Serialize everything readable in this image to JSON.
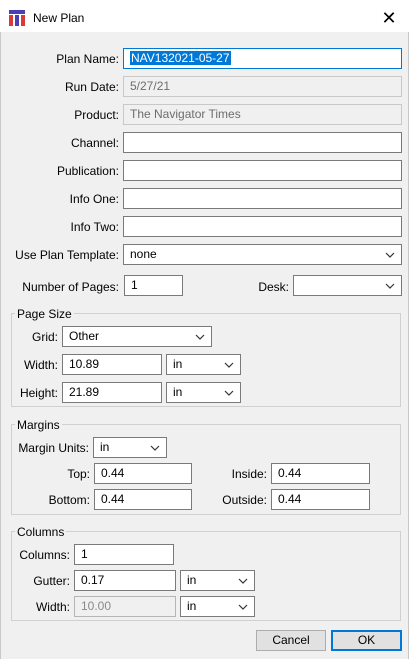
{
  "window": {
    "title": "New Plan"
  },
  "form": {
    "plan_name": {
      "label": "Plan Name:",
      "value": "NAV132021-05-27"
    },
    "run_date": {
      "label": "Run Date:",
      "value": "5/27/21"
    },
    "product": {
      "label": "Product:",
      "value": "The Navigator Times"
    },
    "channel": {
      "label": "Channel:",
      "value": ""
    },
    "publication": {
      "label": "Publication:",
      "value": ""
    },
    "info_one": {
      "label": "Info One:",
      "value": ""
    },
    "info_two": {
      "label": "Info Two:",
      "value": ""
    },
    "plan_template": {
      "label": "Use Plan Template:",
      "value": "none"
    },
    "num_pages": {
      "label": "Number of Pages:",
      "value": "1"
    },
    "desk": {
      "label": "Desk:",
      "value": ""
    }
  },
  "page_size": {
    "legend": "Page Size",
    "grid": {
      "label": "Grid:",
      "value": "Other"
    },
    "width": {
      "label": "Width:",
      "value": "10.89",
      "unit": "in"
    },
    "height": {
      "label": "Height:",
      "value": "21.89",
      "unit": "in"
    }
  },
  "margins": {
    "legend": "Margins",
    "units": {
      "label": "Margin Units:",
      "value": "in"
    },
    "top": {
      "label": "Top:",
      "value": "0.44"
    },
    "inside": {
      "label": "Inside:",
      "value": "0.44"
    },
    "bottom": {
      "label": "Bottom:",
      "value": "0.44"
    },
    "outside": {
      "label": "Outside:",
      "value": "0.44"
    }
  },
  "columns": {
    "legend": "Columns",
    "count": {
      "label": "Columns:",
      "value": "1"
    },
    "gutter": {
      "label": "Gutter:",
      "value": "0.17",
      "unit": "in"
    },
    "width": {
      "label": "Width:",
      "value": "10.00",
      "unit": "in"
    }
  },
  "buttons": {
    "cancel": "Cancel",
    "ok": "OK"
  },
  "colors": {
    "accent": "#0078d7",
    "window_bg": "#f0f0f0"
  },
  "icons": {
    "app": "plan-grid-icon",
    "close": "close-icon",
    "dropdown": "chevron-down-icon"
  }
}
